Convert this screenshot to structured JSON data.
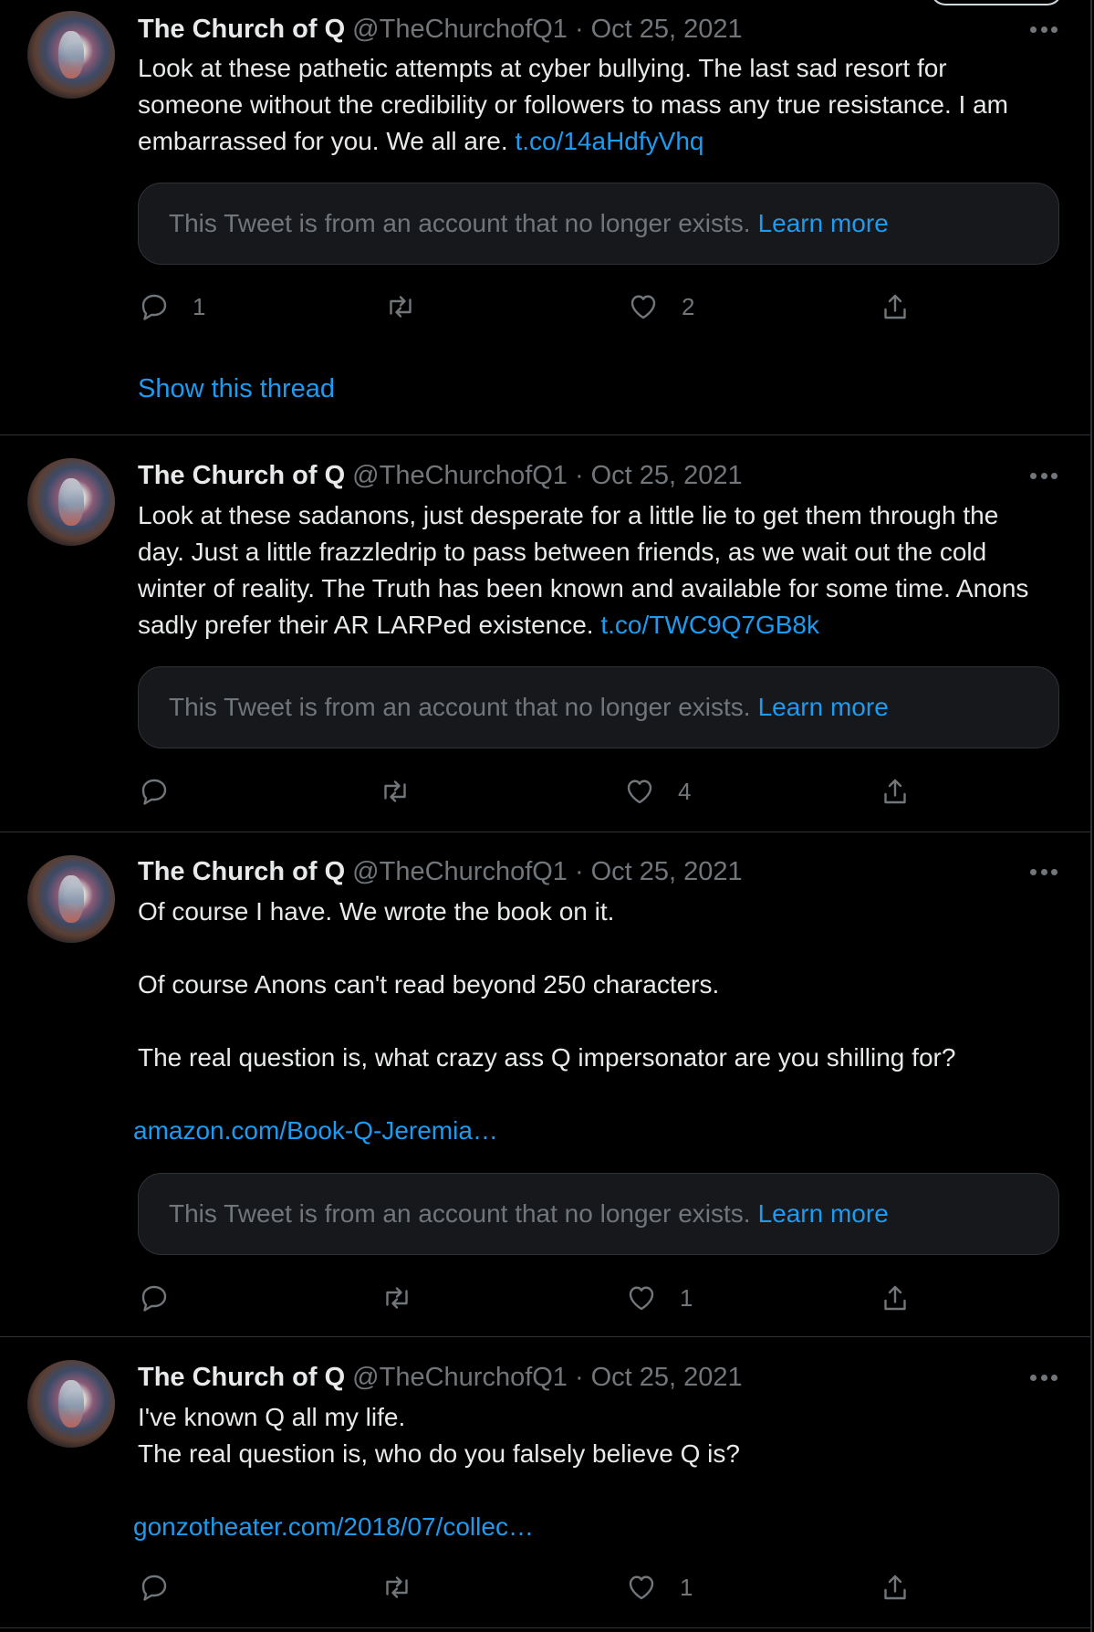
{
  "tweets": [
    {
      "name": "The Church of Q",
      "handle": "@TheChurchofQ1",
      "dot": "·",
      "date": "Oct 25, 2021",
      "text": "Look at these pathetic attempts at cyber bullying. The last sad resort for someone without the credibility or followers to mass any true resistance. I am embarrassed for you. We all are.",
      "link": "t.co/14aHdfyVhq",
      "quote": {
        "text": "This Tweet is from an account that no longer exists.",
        "learn_more": "Learn more"
      },
      "replies": "1",
      "retweets": "",
      "likes": "2",
      "show_thread": "Show this thread"
    },
    {
      "name": "The Church of Q",
      "handle": "@TheChurchofQ1",
      "dot": "·",
      "date": "Oct 25, 2021",
      "text": "Look at these sadanons, just desperate for a little lie to get them through the day. Just a little frazzledrip to pass between friends, as we wait out the cold winter of reality. The Truth has been known and available for some time. Anons sadly prefer their AR LARPed existence.",
      "link": "t.co/TWC9Q7GB8k",
      "quote": {
        "text": "This Tweet is from an account that no longer exists.",
        "learn_more": "Learn more"
      },
      "replies": "",
      "retweets": "",
      "likes": "4"
    },
    {
      "name": "The Church of Q",
      "handle": "@TheChurchofQ1",
      "dot": "·",
      "date": "Oct 25, 2021",
      "para1": "Of course I have. We wrote the book on it.",
      "para2": "Of course Anons can't read beyond 250 characters.",
      "para3": "The real question is, what crazy ass Q impersonator are you shilling for?",
      "ext_link": "amazon.com/Book-Q-Jeremia…",
      "quote": {
        "text": "This Tweet is from an account that no longer exists.",
        "learn_more": "Learn more"
      },
      "replies": "",
      "retweets": "",
      "likes": "1"
    },
    {
      "name": "The Church of Q",
      "handle": "@TheChurchofQ1",
      "dot": "·",
      "date": "Oct 25, 2021",
      "line1": "I've known Q all my life.",
      "line2": "The real question is, who do you falsely believe Q is?",
      "ext_link": "gonzotheater.com/2018/07/collec…",
      "replies": "",
      "retweets": "",
      "likes": "1"
    }
  ],
  "icons": {
    "reply": "reply-icon",
    "retweet": "retweet-icon",
    "like": "heart-icon",
    "share": "share-icon",
    "more": "more-icon"
  },
  "colors": {
    "background": "#000000",
    "text": "#e7e9ea",
    "secondary": "#71767b",
    "accent": "#1d9bf0",
    "border": "#2f3336",
    "quote_bg": "#16181c"
  }
}
